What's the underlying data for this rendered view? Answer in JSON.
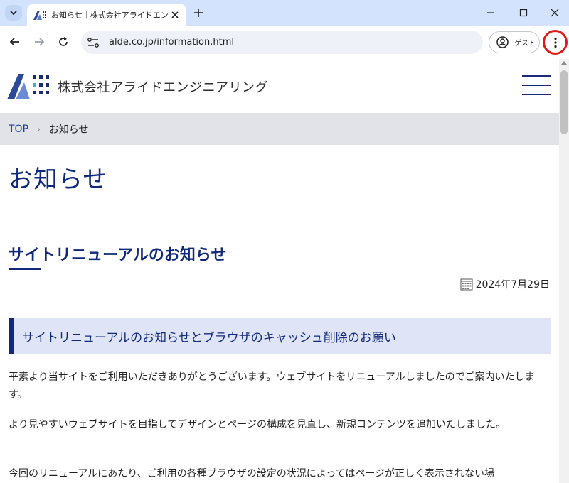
{
  "browser": {
    "tab_title": "お知らせ｜株式会社アライドエンジニアリング",
    "url": "alde.co.jp/information.html",
    "guest_label": "ゲスト"
  },
  "site": {
    "company_name": "株式会社アライドエンジニアリング",
    "breadcrumb": {
      "top": "TOP",
      "separator": "›",
      "current": "お知らせ"
    },
    "page_title": "お知らせ",
    "article": {
      "title": "サイトリニューアルのお知らせ",
      "date": "2024年7月29日",
      "notice_heading": "サイトリニューアルのお知らせとブラウザのキャッシュ削除のお願い",
      "paragraphs": [
        "平素より当サイトをご利用いただきありがとうございます。ウェブサイトをリニューアルしましたのでご案内いたします。",
        "より見やすいウェブサイトを目指してデザインとページの構成を見直し、新規コンテンツを追加いたしました。",
        "今回のリニューアルにあたり、ご利用の各種ブラウザの設定の状況によってはページが正しく表示されない場"
      ]
    }
  },
  "colors": {
    "brand_navy": "#11297a",
    "highlight_red": "#e01a1a",
    "tabstrip": "#d3e3fd"
  },
  "icons": [
    "tab-search-icon",
    "favicon-icon",
    "close-icon",
    "plus-icon",
    "minimize-icon",
    "maximize-icon",
    "back-icon",
    "forward-icon",
    "reload-icon",
    "site-info-icon",
    "guest-profile-icon",
    "kebab-menu-icon",
    "hamburger-menu-icon",
    "calendar-icon"
  ]
}
